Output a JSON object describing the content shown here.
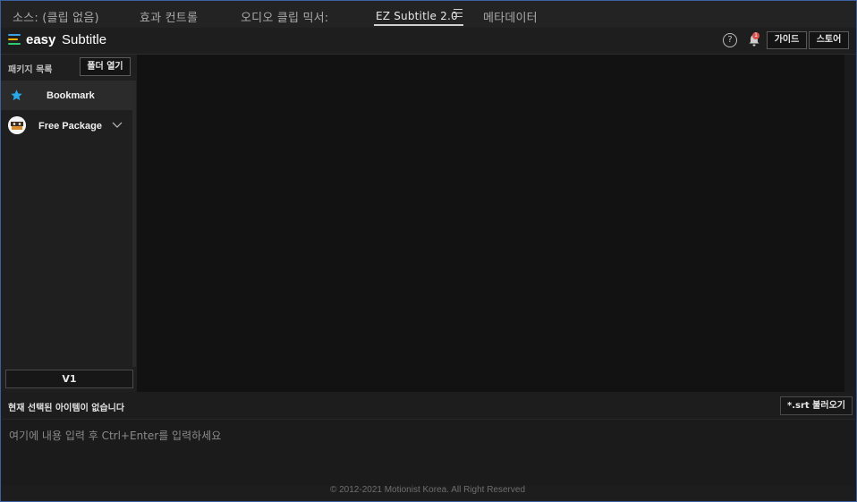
{
  "tabs": [
    {
      "label": "소스: (클립 없음)"
    },
    {
      "label": "효과 컨트롤"
    },
    {
      "label": "오디오 클립 믹서:"
    },
    {
      "label": "EZ Subtitle 2.0"
    },
    {
      "label": "메타데이터"
    }
  ],
  "active_tab": "EZ Subtitle 2.0",
  "header": {
    "logo_bold": "easy",
    "logo_light": "Subtitle",
    "help_icon": "?",
    "notification_count": "1",
    "guide_button": "가이드",
    "store_button": "스토어"
  },
  "sidebar": {
    "title": "패키지 목록",
    "open_folder_button": "폴더 열기",
    "items": [
      {
        "label": "Bookmark",
        "icon": "star-icon"
      },
      {
        "label": "Free Package",
        "icon": "package-avatar"
      }
    ],
    "version_button": "V1"
  },
  "bottom": {
    "status_text": "현재 선택된 아이템이 없습니다",
    "srt_button": "*.srt 불러오기",
    "input_placeholder": "여기에 내용 입력 후 Ctrl+Enter를 입력하세요",
    "footer": "© 2012-2021 Motionist Korea. All Right Reserved"
  },
  "colors": {
    "accent_star": "#29a8e6",
    "border": "#3b5fa0",
    "logo_lines": [
      "#3aa0e8",
      "#f4b400",
      "#2ecc71"
    ]
  }
}
